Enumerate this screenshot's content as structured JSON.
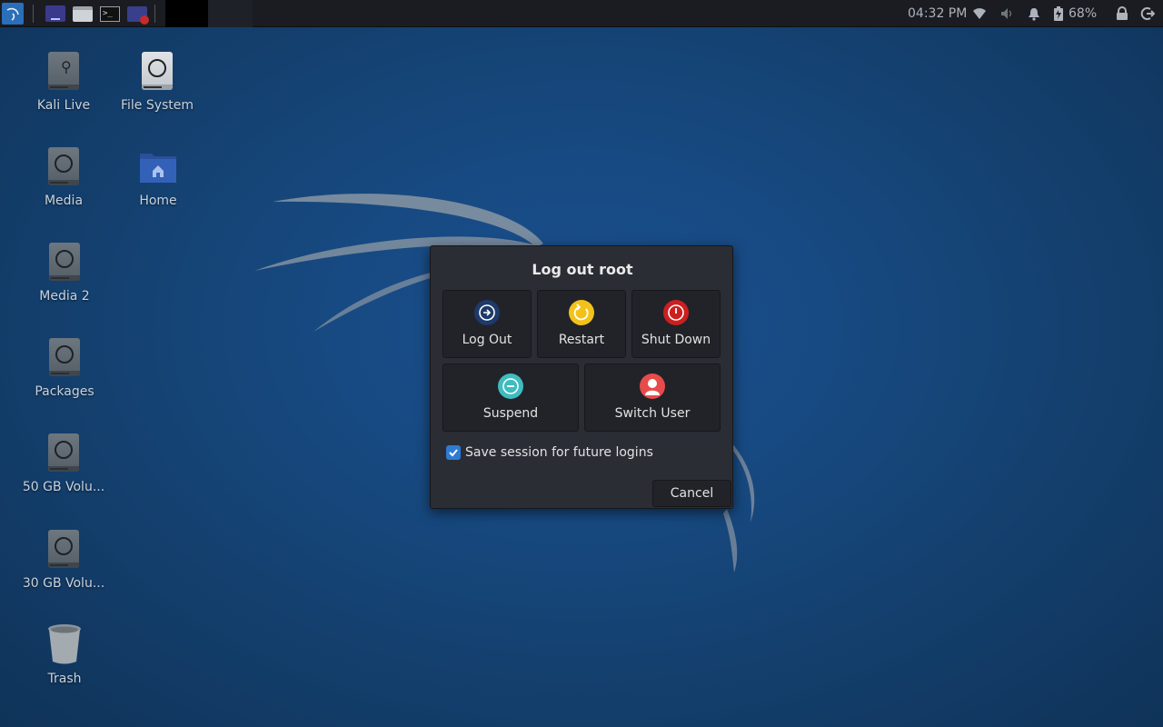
{
  "panel": {
    "clock": "04:32 PM",
    "battery": "68%",
    "launchers": [
      "kali-menu-icon",
      "window-icon",
      "files-icon",
      "terminal-icon",
      "screenshot-icon"
    ],
    "tray_icons": [
      "wifi-icon",
      "volume-icon",
      "notifications-icon",
      "battery-icon",
      "lock-icon",
      "logout-icon"
    ]
  },
  "desktop": {
    "icons": [
      {
        "label": "Kali Live",
        "icon": "usb-drive-icon"
      },
      {
        "label": "File System",
        "icon": "drive-icon"
      },
      {
        "label": "Media",
        "icon": "drive-icon"
      },
      {
        "label": "Home",
        "icon": "home-folder-icon"
      },
      {
        "label": "Media 2",
        "icon": "drive-icon"
      },
      {
        "label": "Packages",
        "icon": "drive-icon"
      },
      {
        "label": "50 GB Volu...",
        "icon": "drive-icon"
      },
      {
        "label": "30 GB Volu...",
        "icon": "drive-icon"
      },
      {
        "label": "Trash",
        "icon": "trash-icon"
      }
    ]
  },
  "dialog": {
    "title": "Log out root",
    "actions": [
      {
        "label": "Log Out",
        "icon": "logout-arrow-icon",
        "color": "#1e3a6b"
      },
      {
        "label": "Restart",
        "icon": "restart-icon",
        "color": "#f2c21b"
      },
      {
        "label": "Shut Down",
        "icon": "power-icon",
        "color": "#cc1f1f"
      },
      {
        "label": "Suspend",
        "icon": "suspend-icon",
        "color": "#3fbcc0"
      },
      {
        "label": "Switch User",
        "icon": "user-icon",
        "color": "#e84b4b"
      }
    ],
    "save_session_label": "Save session for future logins",
    "save_session_checked": true,
    "cancel_label": "Cancel"
  },
  "colors": {
    "accent": "#2e7bd3",
    "panel": "#1a1c22",
    "dialog": "#2b2d35"
  }
}
